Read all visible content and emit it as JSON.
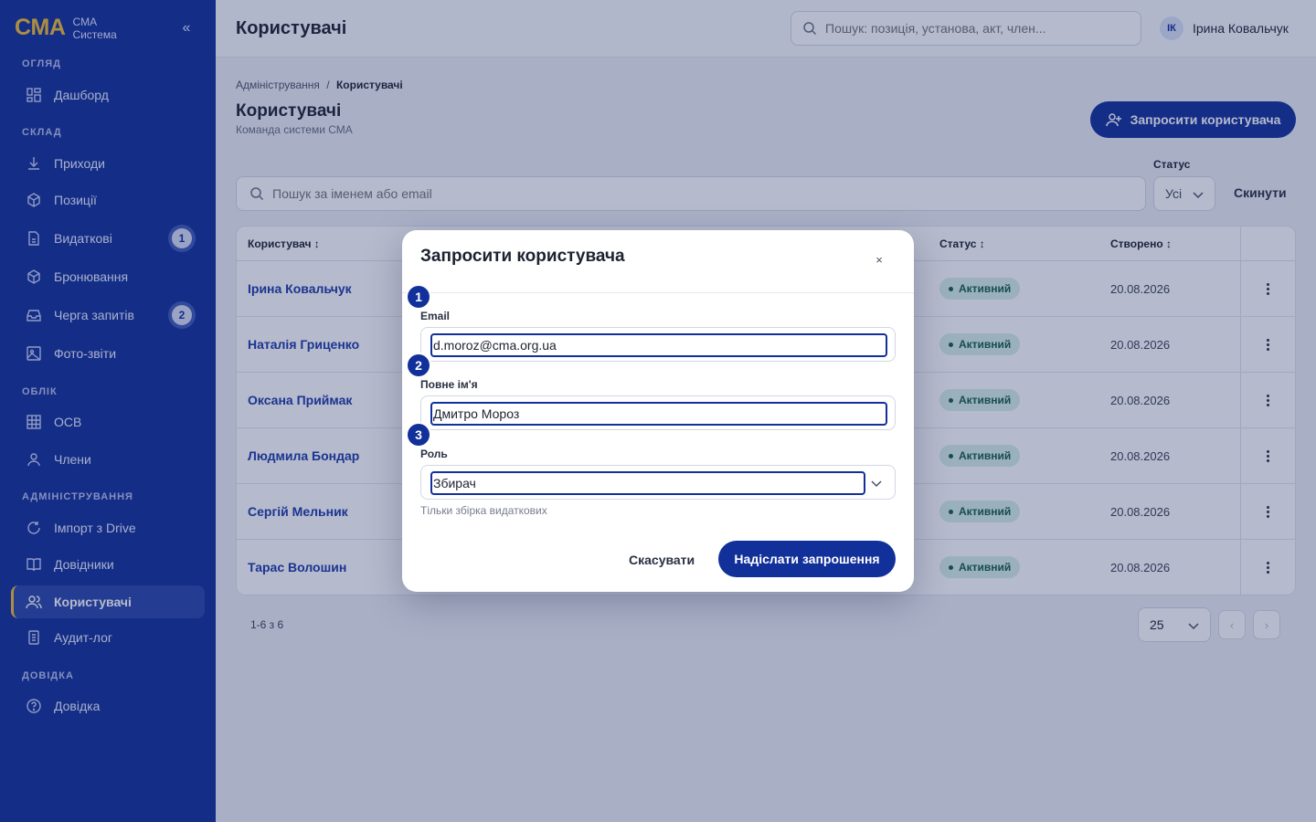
{
  "brand": {
    "logo": "CMA",
    "line1": "CMA",
    "line2": "Система",
    "collapse": "«"
  },
  "sidebar": {
    "sections": [
      "ОГЛЯД",
      "СКЛАД",
      "ОБЛІК",
      "АДМІНІСТРУВАННЯ",
      "ДОВІДКА"
    ],
    "items": [
      {
        "label": "Дашборд",
        "icon": "dashboard-icon"
      },
      {
        "label": "Приходи",
        "icon": "download-icon"
      },
      {
        "label": "Позиції",
        "icon": "box-icon"
      },
      {
        "label": "Видаткові",
        "icon": "document-icon",
        "badge": "1"
      },
      {
        "label": "Бронювання",
        "icon": "box-icon"
      },
      {
        "label": "Черга запитів",
        "icon": "inbox-icon",
        "badge": "2"
      },
      {
        "label": "Фото-звіти",
        "icon": "image-icon"
      },
      {
        "label": "ОСВ",
        "icon": "grid-icon"
      },
      {
        "label": "Члени",
        "icon": "user-icon"
      },
      {
        "label": "Імпорт з Drive",
        "icon": "refresh-icon"
      },
      {
        "label": "Довідники",
        "icon": "book-icon"
      },
      {
        "label": "Користувачі",
        "icon": "users-icon",
        "active": true
      },
      {
        "label": "Аудит-лог",
        "icon": "log-icon"
      },
      {
        "label": "Довідка",
        "icon": "help-icon"
      }
    ]
  },
  "topbar": {
    "title": "Користувачі",
    "search_placeholder": "Пошук: позиція, установа, акт, член...",
    "user_initials": "ІК",
    "user_name": "Ірина Ковальчук"
  },
  "main": {
    "breadcrumb": {
      "parent": "Адміністрування",
      "sep": "/",
      "current": "Користувачі"
    },
    "title": "Користувачі",
    "subtitle": "Команда системи СМА",
    "invite_button": "Запросити користувача",
    "search_placeholder": "Пошук за іменем або email",
    "status_label": "Статус",
    "status_value": "Усі",
    "reset_button": "Скинути"
  },
  "table": {
    "columns": {
      "user": "Користувач ↕",
      "status": "Статус ↕",
      "created": "Створено ↕"
    },
    "rows": [
      {
        "name": "Ірина Ковальчук",
        "status": "Активний",
        "created": "20.08.2026"
      },
      {
        "name": "Наталія Гриценко",
        "status": "Активний",
        "created": "20.08.2026"
      },
      {
        "name": "Оксана Приймак",
        "status": "Активний",
        "created": "20.08.2026"
      },
      {
        "name": "Людмила Бондар",
        "status": "Активний",
        "created": "20.08.2026"
      },
      {
        "name": "Сергій Мельник",
        "status": "Активний",
        "created": "20.08.2026"
      },
      {
        "name": "Тарас Волошин",
        "status": "Активний",
        "created": "20.08.2026"
      }
    ]
  },
  "pagination": {
    "range": "1-6 з 6",
    "per_page": "25",
    "prev": "‹",
    "next": "›"
  },
  "modal": {
    "title": "Запросити користувача",
    "close": "×",
    "fields": [
      {
        "step": "1",
        "label": "Email",
        "value": "d.moroz@cma.org.ua"
      },
      {
        "step": "2",
        "label": "Повне ім'я",
        "value": "Дмитро Мороз"
      },
      {
        "step": "3",
        "label": "Роль",
        "value": "Збирач"
      }
    ],
    "role_hint": "Тільки збірка видаткових",
    "cancel": "Скасувати",
    "submit": "Надіслати запрошення"
  },
  "colors": {
    "primary": "#12309a",
    "accent": "#f2bf34",
    "success_bg": "#d8f0e8",
    "success_text": "#176145"
  }
}
